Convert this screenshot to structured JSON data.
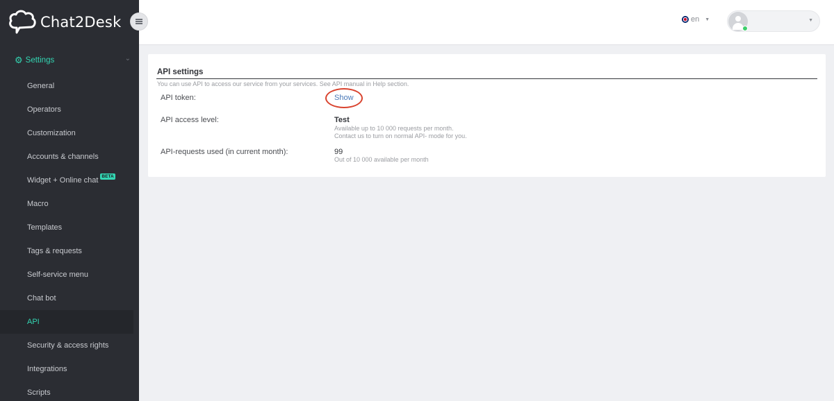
{
  "app": {
    "logo_text": "Chat2Desk"
  },
  "sidebar": {
    "section_label": "Settings",
    "items": [
      {
        "label": "General",
        "active": false
      },
      {
        "label": "Operators",
        "active": false
      },
      {
        "label": "Customization",
        "active": false
      },
      {
        "label": "Accounts & channels",
        "active": false
      },
      {
        "label": "Widget + Online chat",
        "badge": "BETA",
        "active": false
      },
      {
        "label": "Macro",
        "active": false
      },
      {
        "label": "Templates",
        "active": false
      },
      {
        "label": "Tags & requests",
        "active": false
      },
      {
        "label": "Self-service menu",
        "active": false
      },
      {
        "label": "Chat bot",
        "active": false
      },
      {
        "label": "API",
        "active": true
      },
      {
        "label": "Security & access rights",
        "active": false
      },
      {
        "label": "Integrations",
        "active": false
      },
      {
        "label": "Scripts",
        "active": false
      }
    ]
  },
  "header": {
    "language": "en"
  },
  "api_settings": {
    "title": "API settings",
    "description": "You can use API to access our service from your services. See API manual in Help section.",
    "token_label": "API token:",
    "token_action": "Show",
    "access_label": "API access level:",
    "access_value": "Test",
    "access_note_1": "Available up to 10 000 requests per month.",
    "access_note_2": "Contact us to turn on normal API- mode for you.",
    "requests_label": "API-requests used (in current month):",
    "requests_value": "99",
    "requests_note": "Out of 10 000 available per month"
  },
  "colors": {
    "accent": "#33d6b3",
    "sidebar_bg": "#2b2d33",
    "link": "#4a79b8",
    "highlight": "#d9432e"
  }
}
